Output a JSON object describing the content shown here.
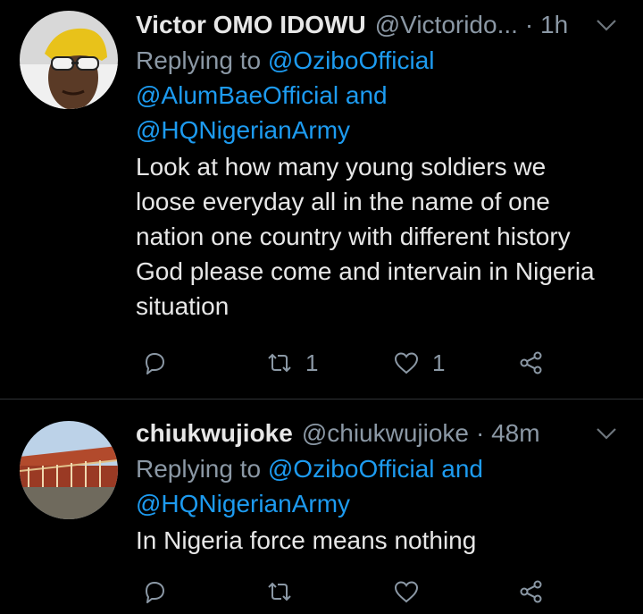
{
  "tweets": [
    {
      "name": "Victor OMO IDOWU",
      "handle": "@Victorido...",
      "time": "· 1h",
      "replying_prefix": "Replying to",
      "mentions_line1": "@OziboOfficial",
      "mentions_line2": "@AlumBaeOfficial and",
      "mentions_line3": "@HQNigerianArmy",
      "text_lines": [
        "Look at how many young soldiers we",
        "loose everyday all in the name of one",
        "nation one country with different history",
        "God please come and intervain in Nigeria",
        "situation"
      ],
      "retweet_count": "1",
      "like_count": "1"
    },
    {
      "name": "chiukwujioke",
      "handle": "@chiukwujioke",
      "time": "· 48m",
      "replying_prefix": "Replying to",
      "mentions_line1": "@OziboOfficial and",
      "mentions_line2": "@HQNigerianArmy",
      "text_lines": [
        "In Nigeria force means nothing"
      ]
    }
  ],
  "icons": {
    "reply": "reply-icon",
    "retweet": "retweet-icon",
    "like": "heart-icon",
    "share": "share-icon",
    "more": "chevron-down-icon"
  },
  "colors": {
    "background": "#000000",
    "mention": "#1d9bf0",
    "secondary": "#8b98a5",
    "primary_text": "#e7e7e7"
  }
}
